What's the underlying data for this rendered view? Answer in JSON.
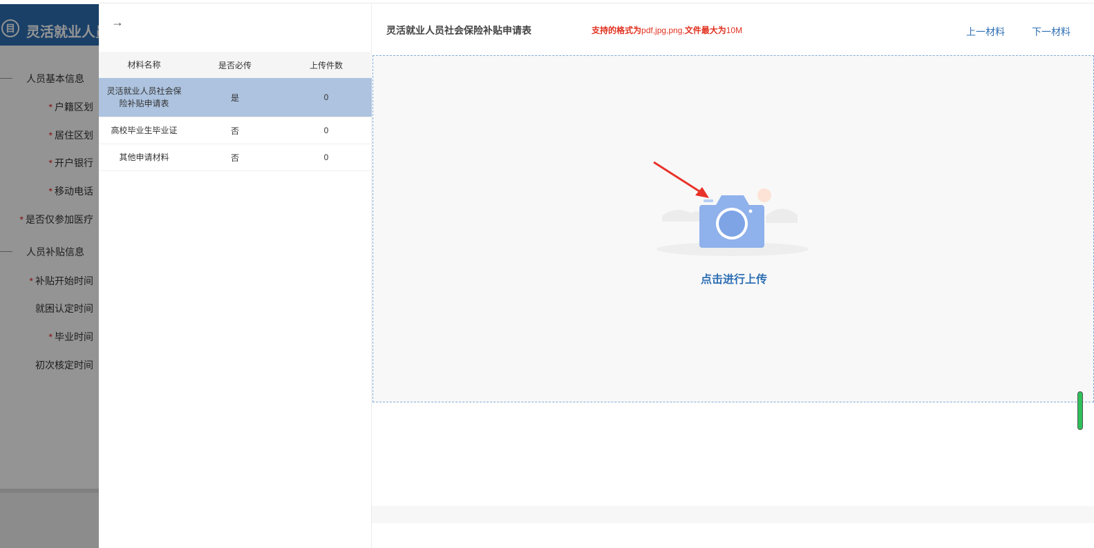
{
  "background": {
    "logo_glyph": "目",
    "app_title": "灵活就业人员",
    "sections": [
      {
        "label": "人员基本信息"
      },
      {
        "label": "人员补贴信息"
      }
    ],
    "fields_basic": [
      {
        "label": "户籍区划",
        "required": true
      },
      {
        "label": "居住区划",
        "required": true
      },
      {
        "label": "开户银行",
        "required": true
      },
      {
        "label": "移动电话",
        "required": true
      },
      {
        "label": "是否仅参加医疗",
        "required": true
      }
    ],
    "fields_subsidy": [
      {
        "label": "补贴开始时间",
        "required": true
      },
      {
        "label": "就困认定时间",
        "required": false
      },
      {
        "label": "毕业时间",
        "required": true
      },
      {
        "label": "初次核定时间",
        "required": false
      }
    ],
    "required_mark": "*"
  },
  "drawer": {
    "back_icon": "→",
    "table": {
      "headers": [
        "材料名称",
        "是否必传",
        "上传件数"
      ],
      "rows": [
        {
          "name": "灵活就业人员社会保险补贴申请表",
          "required": "是",
          "count": "0",
          "selected": true
        },
        {
          "name": "高校毕业生毕业证",
          "required": "否",
          "count": "0",
          "selected": false
        },
        {
          "name": "其他申请材料",
          "required": "否",
          "count": "0",
          "selected": false
        }
      ]
    },
    "doc_title": "灵活就业人员社会保险补贴申请表",
    "format_tip_prefix": "支持的格式为",
    "format_tip_formats": "pdf,jpg,png,",
    "format_tip_middle": "文件最大为",
    "format_tip_size": "10M",
    "prev_button": "上一材料",
    "next_button": "下一材料",
    "upload_text": "点击进行上传"
  },
  "colors": {
    "brand_blue": "#2e6fb4",
    "selected_row": "#adc3df",
    "tip_red": "#e0301e",
    "camera_blue": "#8fb1ec"
  }
}
